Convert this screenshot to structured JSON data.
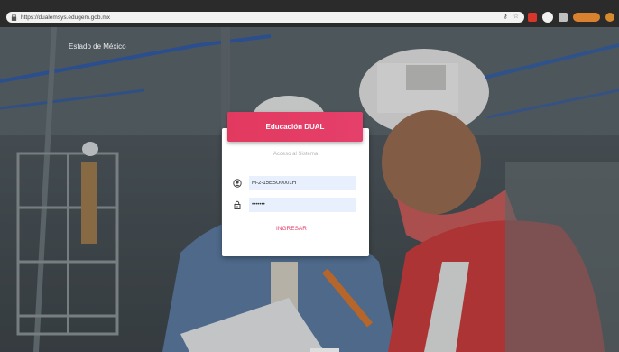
{
  "browser": {
    "url": "https://dualemsys.edugem.gob.mx"
  },
  "page": {
    "site_title": "Estado de México"
  },
  "login": {
    "header": "Educación DUAL",
    "subtitle": "Acceso al Sistema",
    "username_value": "M-2-15ESU0001H",
    "password_value": "•••••••",
    "submit_label": "INGRESAR"
  },
  "icons": {
    "lock": "lock-icon",
    "user": "user-icon",
    "password": "padlock-icon",
    "star": "star-icon",
    "key": "key-icon"
  },
  "colors": {
    "accent": "#e2395f",
    "field_bg": "#e8f0fe",
    "card_bg": "#ffffff"
  }
}
